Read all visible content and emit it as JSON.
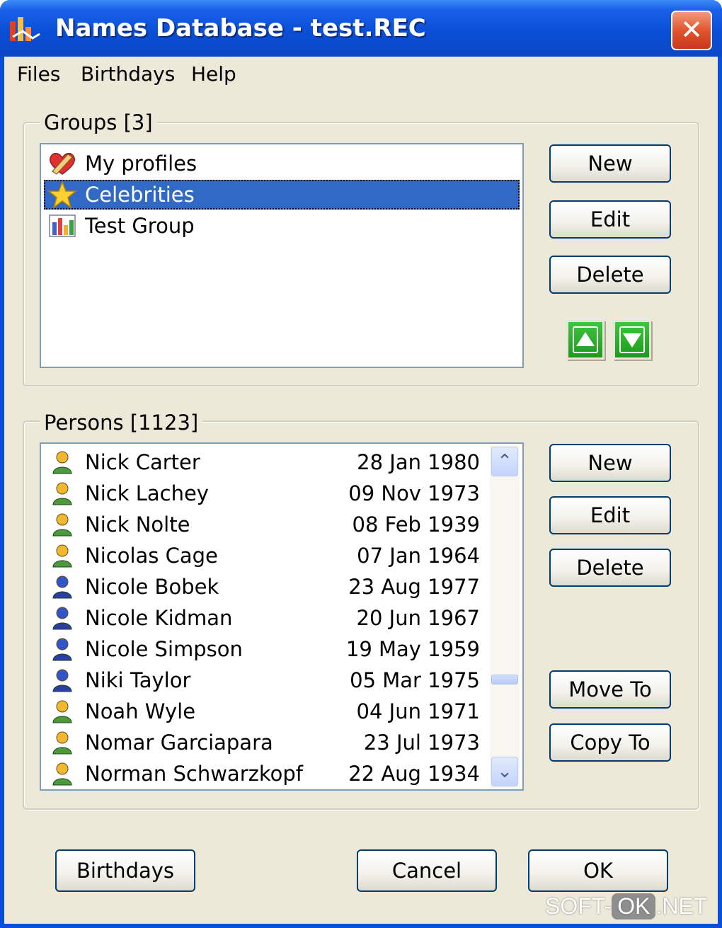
{
  "window": {
    "title": "Names Database - test.REC",
    "close_label": "✕"
  },
  "menu": {
    "items": [
      "Files",
      "Birthdays",
      "Help"
    ]
  },
  "groups": {
    "title": "Groups [3]",
    "items": [
      {
        "label": "My profiles",
        "icon": "heart-pencil-icon",
        "selected": false
      },
      {
        "label": "Celebrities",
        "icon": "star-icon",
        "selected": true
      },
      {
        "label": "Test Group",
        "icon": "bar-chart-icon",
        "selected": false
      }
    ],
    "buttons": {
      "new": "New",
      "edit": "Edit",
      "delete": "Delete"
    },
    "move_up_icon": "arrow-up-icon",
    "move_down_icon": "arrow-down-icon"
  },
  "persons": {
    "title": "Persons [1123]",
    "rows": [
      {
        "name": "Nick Carter",
        "date": "28 Jan 1980",
        "gender": "male"
      },
      {
        "name": "Nick Lachey",
        "date": "09 Nov 1973",
        "gender": "male"
      },
      {
        "name": "Nick Nolte",
        "date": "08 Feb 1939",
        "gender": "male"
      },
      {
        "name": "Nicolas Cage",
        "date": "07 Jan 1964",
        "gender": "male"
      },
      {
        "name": "Nicole Bobek",
        "date": "23 Aug 1977",
        "gender": "female"
      },
      {
        "name": "Nicole Kidman",
        "date": "20 Jun 1967",
        "gender": "female"
      },
      {
        "name": "Nicole Simpson",
        "date": "19 May 1959",
        "gender": "female"
      },
      {
        "name": "Niki Taylor",
        "date": "05 Mar 1975",
        "gender": "female"
      },
      {
        "name": "Noah Wyle",
        "date": "04 Jun 1971",
        "gender": "male"
      },
      {
        "name": "Nomar Garciapara",
        "date": "23 Jul 1973",
        "gender": "male"
      },
      {
        "name": "Norman Schwarzkopf",
        "date": "22 Aug 1934",
        "gender": "male"
      }
    ],
    "buttons": {
      "new": "New",
      "edit": "Edit",
      "delete": "Delete",
      "move_to": "Move To",
      "copy_to": "Copy To"
    },
    "scroll_up": "⌃",
    "scroll_down": "⌄"
  },
  "footer": {
    "birthdays": "Birthdays",
    "cancel": "Cancel",
    "ok": "OK"
  },
  "watermark": {
    "prefix": "SOFT-",
    "ok": "OK",
    "suffix": ".NET"
  },
  "colors": {
    "titlebar": "#0a4fd8",
    "selection": "#316ac5",
    "face": "#ece9d8",
    "male_icon": "#f0b830",
    "female_icon": "#3355cc",
    "arrow_green": "#22a022"
  }
}
